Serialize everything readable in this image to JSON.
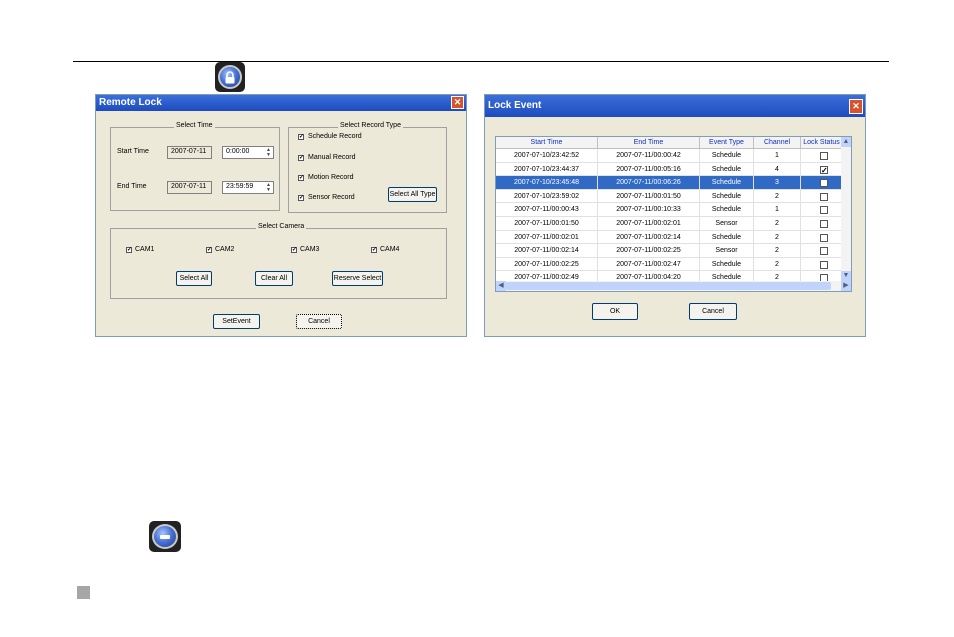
{
  "remote_lock": {
    "title": "Remote Lock",
    "select_time": {
      "label": "Select Time",
      "start_time_label": "Start Time",
      "start_date": "2007-07-11",
      "start_time": "0:00:00",
      "end_time_label": "End Time",
      "end_date": "2007-07-11",
      "end_time": "23:59:59"
    },
    "record_type": {
      "label": "Select Record Type",
      "options": [
        "Schedule Record",
        "Manual Record",
        "Motion Record",
        "Sensor Record"
      ],
      "select_all_label": "Select All Type"
    },
    "camera": {
      "label": "Select Camera",
      "cams": [
        "CAM1",
        "CAM2",
        "CAM3",
        "CAM4"
      ],
      "select_all_label": "Select All",
      "clear_all_label": "Clear All",
      "reverse_select_label": "Reserve Select"
    },
    "set_event_label": "SetEvent",
    "cancel_label": "Cancel"
  },
  "lock_event": {
    "title": "Lock Event",
    "columns": [
      "Start Time",
      "End Time",
      "Event Type",
      "Channel",
      "Lock Status"
    ],
    "rows": [
      {
        "start": "2007-07-10/23:42:52",
        "end": "2007-07-11/00:00:42",
        "type": "Schedule",
        "channel": "1",
        "locked": false
      },
      {
        "start": "2007-07-10/23:44:37",
        "end": "2007-07-11/00:05:16",
        "type": "Schedule",
        "channel": "4",
        "locked": true
      },
      {
        "start": "2007-07-10/23:45:48",
        "end": "2007-07-11/00:06:26",
        "type": "Schedule",
        "channel": "3",
        "locked": true,
        "selected": true
      },
      {
        "start": "2007-07-10/23:59:02",
        "end": "2007-07-11/00:01:50",
        "type": "Schedule",
        "channel": "2",
        "locked": false
      },
      {
        "start": "2007-07-11/00:00:43",
        "end": "2007-07-11/00:10:33",
        "type": "Schedule",
        "channel": "1",
        "locked": false
      },
      {
        "start": "2007-07-11/00:01:50",
        "end": "2007-07-11/00:02:01",
        "type": "Sensor",
        "channel": "2",
        "locked": false
      },
      {
        "start": "2007-07-11/00:02:01",
        "end": "2007-07-11/00:02:14",
        "type": "Schedule",
        "channel": "2",
        "locked": false
      },
      {
        "start": "2007-07-11/00:02:14",
        "end": "2007-07-11/00:02:25",
        "type": "Sensor",
        "channel": "2",
        "locked": false
      },
      {
        "start": "2007-07-11/00:02:25",
        "end": "2007-07-11/00:02:47",
        "type": "Schedule",
        "channel": "2",
        "locked": false
      },
      {
        "start": "2007-07-11/00:02:49",
        "end": "2007-07-11/00:04:20",
        "type": "Schedule",
        "channel": "2",
        "locked": false
      }
    ],
    "ok_label": "OK",
    "cancel_label": "Cancel"
  },
  "icons": {
    "lock_button_icon": "lock-icon",
    "unlock_button_icon": "unlock-icon"
  },
  "colors": {
    "titlebar": "#2454c8",
    "selection": "#316ac5",
    "dialog_bg": "#ece9d8"
  }
}
